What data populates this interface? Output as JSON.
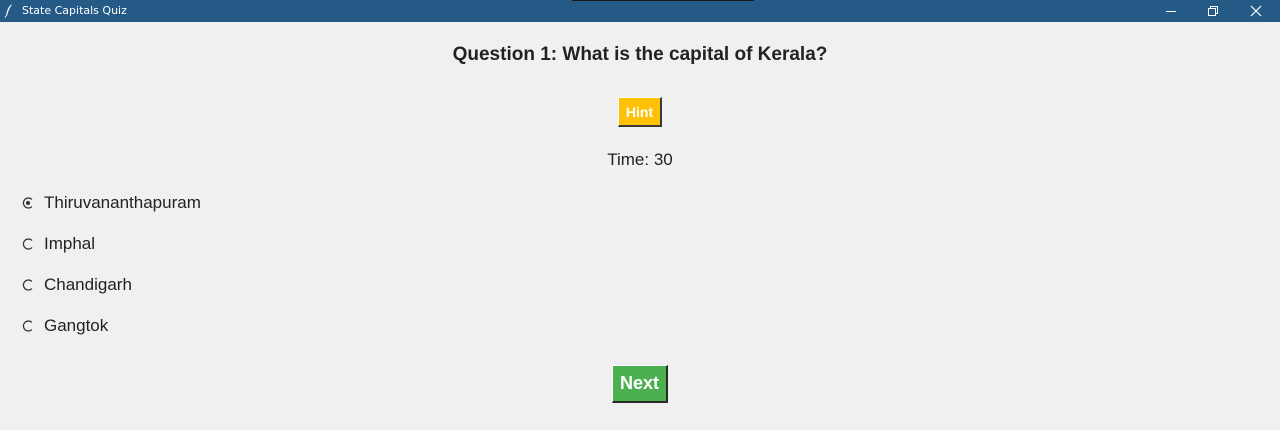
{
  "window": {
    "title": "State Capitals Quiz"
  },
  "quiz": {
    "question": "Question 1: What is the capital of Kerala?",
    "hint_label": "Hint",
    "timer_text": "Time: 30",
    "options": [
      {
        "label": "Thiruvananthapuram",
        "selected": true
      },
      {
        "label": "Imphal",
        "selected": false
      },
      {
        "label": "Chandigarh",
        "selected": false
      },
      {
        "label": "Gangtok",
        "selected": false
      }
    ],
    "next_label": "Next"
  },
  "colors": {
    "titlebar": "#245a85",
    "background": "#f0f0f0",
    "hint_button": "#ffc107",
    "next_button": "#4caf50"
  },
  "icons": {
    "app": "feather-icon",
    "minimize": "minimize-icon",
    "maximize": "restore-icon",
    "close": "close-icon",
    "radio_selected": "radio-selected-icon",
    "radio_unselected": "radio-unselected-icon"
  }
}
